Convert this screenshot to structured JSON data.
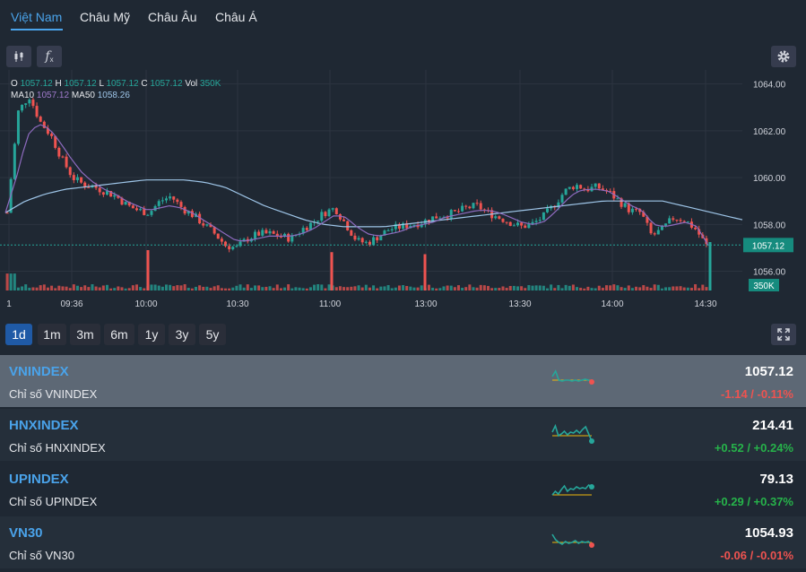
{
  "tabs": [
    {
      "label": "Việt Nam",
      "active": true
    },
    {
      "label": "Châu Mỹ",
      "active": false
    },
    {
      "label": "Châu Âu",
      "active": false
    },
    {
      "label": "Châu Á",
      "active": false
    }
  ],
  "toolbar": {
    "icons": [
      "candlestick-icon",
      "function-icon",
      "gear-icon"
    ]
  },
  "legend": {
    "o_label": "O",
    "o": "1057.12",
    "h_label": "H",
    "h": "1057.12",
    "l_label": "L",
    "l": "1057.12",
    "c_label": "C",
    "c": "1057.12",
    "vol_label": "Vol",
    "vol": "350K",
    "ma10_label": "MA10",
    "ma10": "1057.12",
    "ma50_label": "MA50",
    "ma50": "1058.26"
  },
  "chart_data": {
    "type": "candlestick",
    "symbol": "VNINDEX",
    "y_ticks": [
      "1064.00",
      "1062.00",
      "1060.00",
      "1058.00",
      "1056.00"
    ],
    "ylim": [
      1055.6,
      1064.6
    ],
    "x_ticks": [
      "1",
      "09:36",
      "10:00",
      "10:30",
      "11:00",
      "13:00",
      "13:30",
      "14:00",
      "14:30"
    ],
    "last_price": "1057.12",
    "last_volume": "350K",
    "close_path": [
      1058.5,
      1062.8,
      1063.5,
      1062.4,
      1061.8,
      1060.8,
      1060.0,
      1059.7,
      1059.6,
      1059.4,
      1059.2,
      1058.8,
      1058.6,
      1058.5,
      1059.0,
      1059.2,
      1058.7,
      1058.4,
      1058.0,
      1057.6,
      1057.1,
      1057.0,
      1057.4,
      1057.6,
      1057.6,
      1057.5,
      1057.4,
      1057.8,
      1058.1,
      1058.5,
      1058.7,
      1058.0,
      1057.3,
      1057.2,
      1057.5,
      1057.8,
      1057.9,
      1058.0,
      1058.1,
      1058.3,
      1058.4,
      1058.5,
      1058.7,
      1058.8,
      1058.5,
      1058.3,
      1058.1,
      1057.9,
      1058.0,
      1058.3,
      1058.8,
      1059.4,
      1059.7,
      1059.5,
      1059.6,
      1059.4,
      1059.0,
      1058.6,
      1058.5,
      1057.5,
      1057.8,
      1058.3,
      1058.2,
      1057.8,
      1057.1
    ],
    "ma10_path": [
      1058.5,
      1060.0,
      1061.8,
      1062.3,
      1062.1,
      1061.5,
      1060.8,
      1060.2,
      1059.8,
      1059.5,
      1059.3,
      1059.0,
      1058.8,
      1058.6,
      1058.7,
      1058.8,
      1058.7,
      1058.5,
      1058.2,
      1057.9,
      1057.6,
      1057.3,
      1057.3,
      1057.4,
      1057.5,
      1057.5,
      1057.5,
      1057.6,
      1057.8,
      1058.1,
      1058.4,
      1058.3,
      1057.9,
      1057.6,
      1057.5,
      1057.6,
      1057.7,
      1057.9,
      1058.0,
      1058.1,
      1058.3,
      1058.4,
      1058.5,
      1058.6,
      1058.6,
      1058.5,
      1058.3,
      1058.1,
      1058.0,
      1058.1,
      1058.5,
      1059.0,
      1059.4,
      1059.5,
      1059.5,
      1059.4,
      1059.1,
      1058.8,
      1058.6,
      1058.0,
      1057.9,
      1058.0,
      1058.1,
      1057.9,
      1057.1
    ],
    "ma50_path": [
      1058.5,
      1059.0,
      1059.3,
      1059.5,
      1059.6,
      1059.7,
      1059.8,
      1059.9,
      1059.9,
      1059.9,
      1059.8,
      1059.6,
      1059.2,
      1058.8,
      1058.5,
      1058.2,
      1058.0,
      1057.9,
      1057.9,
      1057.9,
      1058.0,
      1058.1,
      1058.2,
      1058.3,
      1058.4,
      1058.5,
      1058.6,
      1058.7,
      1058.8,
      1058.9,
      1059.0,
      1059.0,
      1059.0,
      1059.0,
      1058.8,
      1058.6,
      1058.4,
      1058.2
    ],
    "volume_spikes": [
      {
        "time": "10:00",
        "volume": 1.0
      },
      {
        "time": "11:00",
        "volume": 0.95
      },
      {
        "time": "13:00",
        "volume": 0.9
      },
      {
        "time": "14:30",
        "volume": 1.2
      }
    ]
  },
  "ranges": [
    {
      "label": "1d",
      "active": true
    },
    {
      "label": "1m",
      "active": false
    },
    {
      "label": "3m",
      "active": false
    },
    {
      "label": "6m",
      "active": false
    },
    {
      "label": "1y",
      "active": false
    },
    {
      "label": "3y",
      "active": false
    },
    {
      "label": "5y",
      "active": false
    }
  ],
  "indices": [
    {
      "symbol": "VNINDEX",
      "name": "Chỉ số VNINDEX",
      "price": "1057.12",
      "change": "-1.14 / -0.11%",
      "direction": "down",
      "selected": true,
      "spark": [
        8,
        2,
        12,
        13,
        12,
        12,
        13,
        12,
        13,
        12,
        11,
        12,
        14
      ],
      "spark_base": 12
    },
    {
      "symbol": "HNXINDEX",
      "name": "Chỉ số HNXINDEX",
      "price": "214.41",
      "change": "+0.52 / +0.24%",
      "direction": "up",
      "selected": false,
      "spark": [
        10,
        3,
        14,
        12,
        9,
        13,
        10,
        11,
        8,
        11,
        7,
        4,
        12,
        20
      ],
      "spark_base": 14
    },
    {
      "symbol": "UPINDEX",
      "name": "Chỉ số UPINDEX",
      "price": "79.13",
      "change": "+0.29 / +0.37%",
      "direction": "up",
      "selected": false,
      "spark": [
        20,
        16,
        19,
        14,
        10,
        16,
        13,
        14,
        11,
        13,
        12,
        13,
        9,
        11
      ],
      "spark_base": 20
    },
    {
      "symbol": "VN30",
      "name": "Chỉ số VN30",
      "price": "1054.93",
      "change": "-0.06 / -0.01%",
      "direction": "down",
      "selected": false,
      "spark": [
        4,
        10,
        13,
        15,
        12,
        14,
        13,
        11,
        14,
        12,
        13,
        12,
        16
      ],
      "spark_base": 13
    }
  ],
  "colors": {
    "up": "#26a69a",
    "down": "#ef5350",
    "ma10": "#8e6bbf",
    "ma50": "#9ec5e8",
    "accent": "#4aa3ea"
  }
}
